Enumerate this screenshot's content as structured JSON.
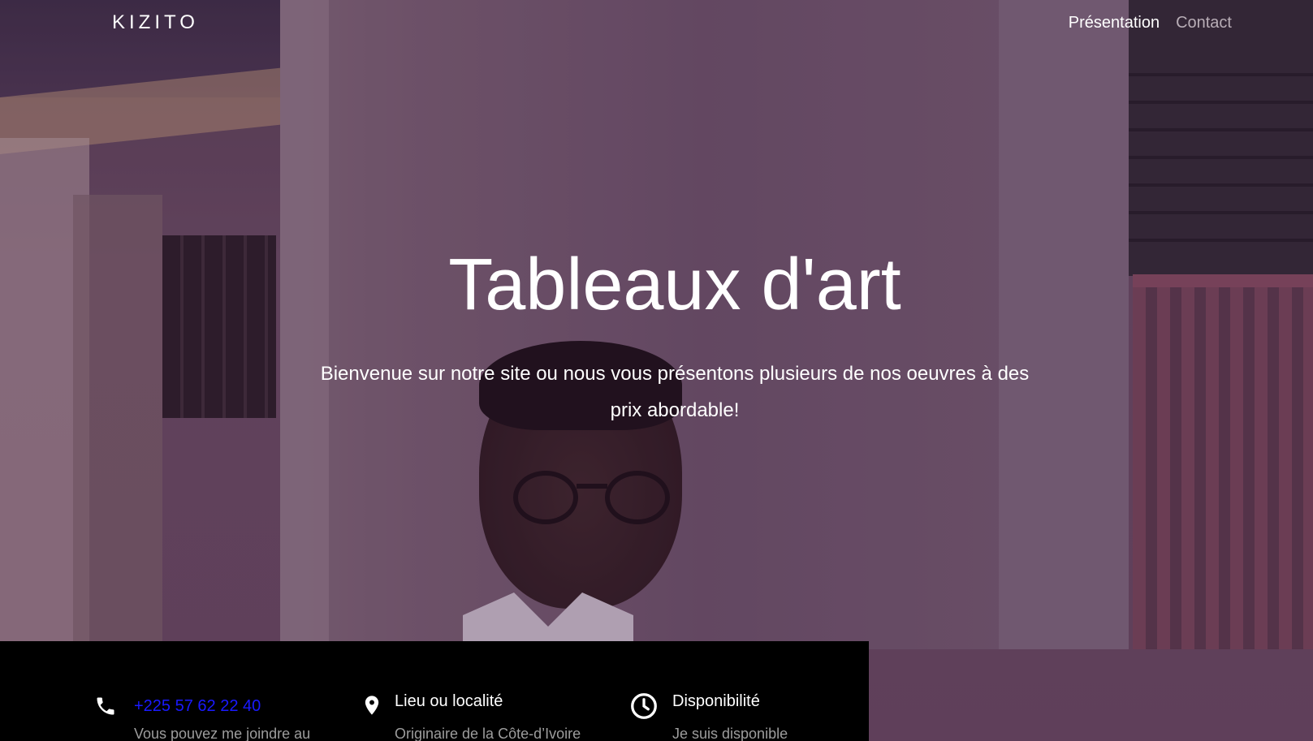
{
  "navbar": {
    "brand": "KIZITO",
    "links": [
      {
        "label": "Présentation",
        "active": true
      },
      {
        "label": "Contact",
        "active": false
      }
    ]
  },
  "hero": {
    "title": "Tableaux d'art",
    "subtitle": "Bienvenue sur notre site ou nous vous présentons plusieurs de nos oeuvres à des prix abordable!"
  },
  "info": [
    {
      "icon": "phone-icon",
      "heading": "+225 57 62 22 40",
      "text": "Vous pouvez me joindre au",
      "heading_color": "#1a1aff"
    },
    {
      "icon": "location-pin-icon",
      "heading": "Lieu ou localité",
      "text": "Originaire de la Côte-d’Ivoire",
      "heading_color": "#ffffff"
    },
    {
      "icon": "clock-icon",
      "heading": "Disponibilité",
      "text": "Je suis disponible",
      "heading_color": "#ffffff"
    }
  ],
  "colors": {
    "band_background": "#000000",
    "link_blue": "#1a1aff",
    "muted_nav": "#b8adb6"
  }
}
